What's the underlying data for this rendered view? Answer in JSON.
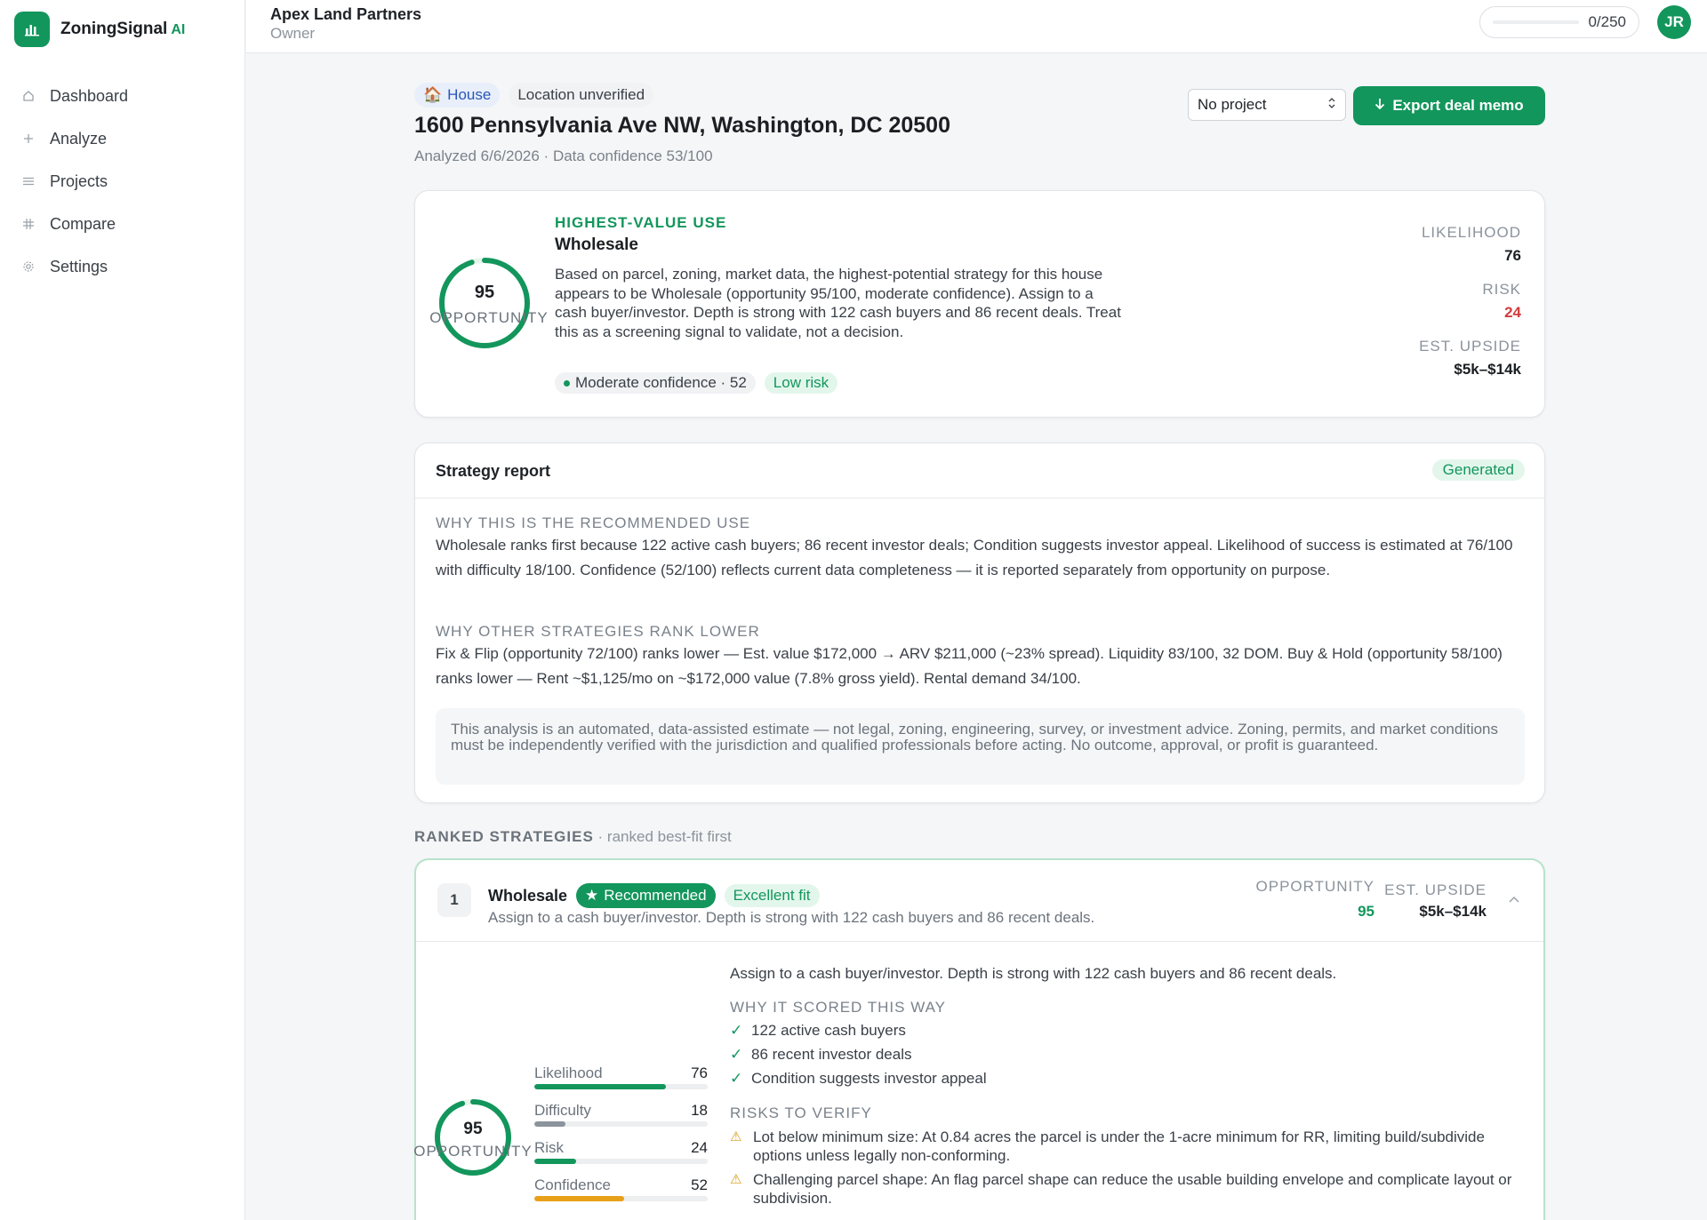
{
  "app": {
    "name": "ZoningSignal",
    "name_suffix": "AI"
  },
  "sidebar": {
    "items": [
      {
        "label": "Dashboard",
        "icon": "home-icon"
      },
      {
        "label": "Analyze",
        "icon": "plus-icon"
      },
      {
        "label": "Projects",
        "icon": "list-icon"
      },
      {
        "label": "Compare",
        "icon": "grid-icon"
      },
      {
        "label": "Settings",
        "icon": "gear-icon"
      }
    ]
  },
  "header": {
    "org_name": "Apex Land Partners",
    "org_role": "Owner",
    "usage_text": "0/250",
    "usage_fraction": 0,
    "avatar_initials": "JR"
  },
  "property": {
    "type_chip": "House",
    "location_chip": "Location unverified",
    "address": "1600 Pennsylvania Ave NW, Washington, DC 20500",
    "meta": "Analyzed 6/6/2026 · Data confidence 53/100",
    "project_select": "No project",
    "export_label": "Export deal memo"
  },
  "summary": {
    "score": "95",
    "score_label": "OPPORTUNITY",
    "score_fraction": 0.95,
    "hv_label": "HIGHEST-VALUE USE",
    "hv_use": "Wholesale",
    "description": "Based on parcel, zoning, market data, the highest-potential strategy for this house appears to be Wholesale (opportunity 95/100, moderate confidence). Assign to a cash buyer/investor. Depth is strong with 122 cash buyers and 86 recent deals. Treat this as a screening signal to validate, not a decision.",
    "confidence_badge": "Moderate confidence · 52",
    "risk_badge": "Low risk",
    "likelihood_label": "LIKELIHOOD",
    "likelihood": "76",
    "risk_label": "RISK",
    "risk": "24",
    "upside_label": "EST. UPSIDE",
    "upside": "$5k–$14k"
  },
  "report": {
    "title": "Strategy report",
    "status": "Generated",
    "why_heading": "WHY THIS IS THE RECOMMENDED USE",
    "why_text": "Wholesale ranks first because 122 active cash buyers; 86 recent investor deals; Condition suggests investor appeal. Likelihood of success is estimated at 76/100 with difficulty 18/100. Confidence (52/100) reflects current data completeness — it is reported separately from opportunity on purpose.",
    "other_heading": "WHY OTHER STRATEGIES RANK LOWER",
    "other_text": "Fix & Flip (opportunity 72/100) ranks lower — Est. value $172,000 → ARV $211,000 (~23% spread). Liquidity 83/100, 32 DOM. Buy & Hold (opportunity 58/100) ranks lower — Rent ~$1,125/mo on ~$172,000 value (7.8% gross yield). Rental demand 34/100.",
    "disclaimer": "This analysis is an automated, data-assisted estimate — not legal, zoning, engineering, survey, or investment advice. Zoning, permits, and market conditions must be independently verified with the jurisdiction and qualified professionals before acting. No outcome, approval, or profit is guaranteed."
  },
  "ranked": {
    "heading": "RANKED STRATEGIES",
    "subheading": "· ranked best-fit first"
  },
  "strategy": {
    "rank": "1",
    "name": "Wholesale",
    "recommended": "Recommended",
    "fit": "Excellent fit",
    "subtitle": "Assign to a cash buyer/investor. Depth is strong with 122 cash buyers and 86 recent deals.",
    "opportunity_label": "OPPORTUNITY",
    "opportunity": "95",
    "upside_label": "EST. UPSIDE",
    "upside": "$5k–$14k",
    "score": "95",
    "score_label": "OPPORTUNITY",
    "score_fraction": 0.95,
    "metrics": [
      {
        "label": "Likelihood",
        "value": "76",
        "fraction": 0.76,
        "color": "#13965c"
      },
      {
        "label": "Difficulty",
        "value": "18",
        "fraction": 0.18,
        "color": "#8b939c"
      },
      {
        "label": "Risk",
        "value": "24",
        "fraction": 0.24,
        "color": "#13965c"
      },
      {
        "label": "Confidence",
        "value": "52",
        "fraction": 0.52,
        "color": "#e8a019"
      }
    ],
    "intro": "Assign to a cash buyer/investor. Depth is strong with 122 cash buyers and 86 recent deals.",
    "why_heading": "WHY IT SCORED THIS WAY",
    "reasons": [
      "122 active cash buyers",
      "86 recent investor deals",
      "Condition suggests investor appeal"
    ],
    "risks_heading": "RISKS TO VERIFY",
    "risks": [
      "Lot below minimum size: At 0.84 acres the parcel is under the 1-acre minimum for RR, limiting build/subdivide options unless legally non-conforming.",
      "Challenging parcel shape: An flag parcel shape can reduce the usable building envelope and complicate layout or subdivision."
    ]
  },
  "colors": {
    "accent": "#13965c",
    "risk": "#d13d3d",
    "warning": "#e8a019"
  }
}
